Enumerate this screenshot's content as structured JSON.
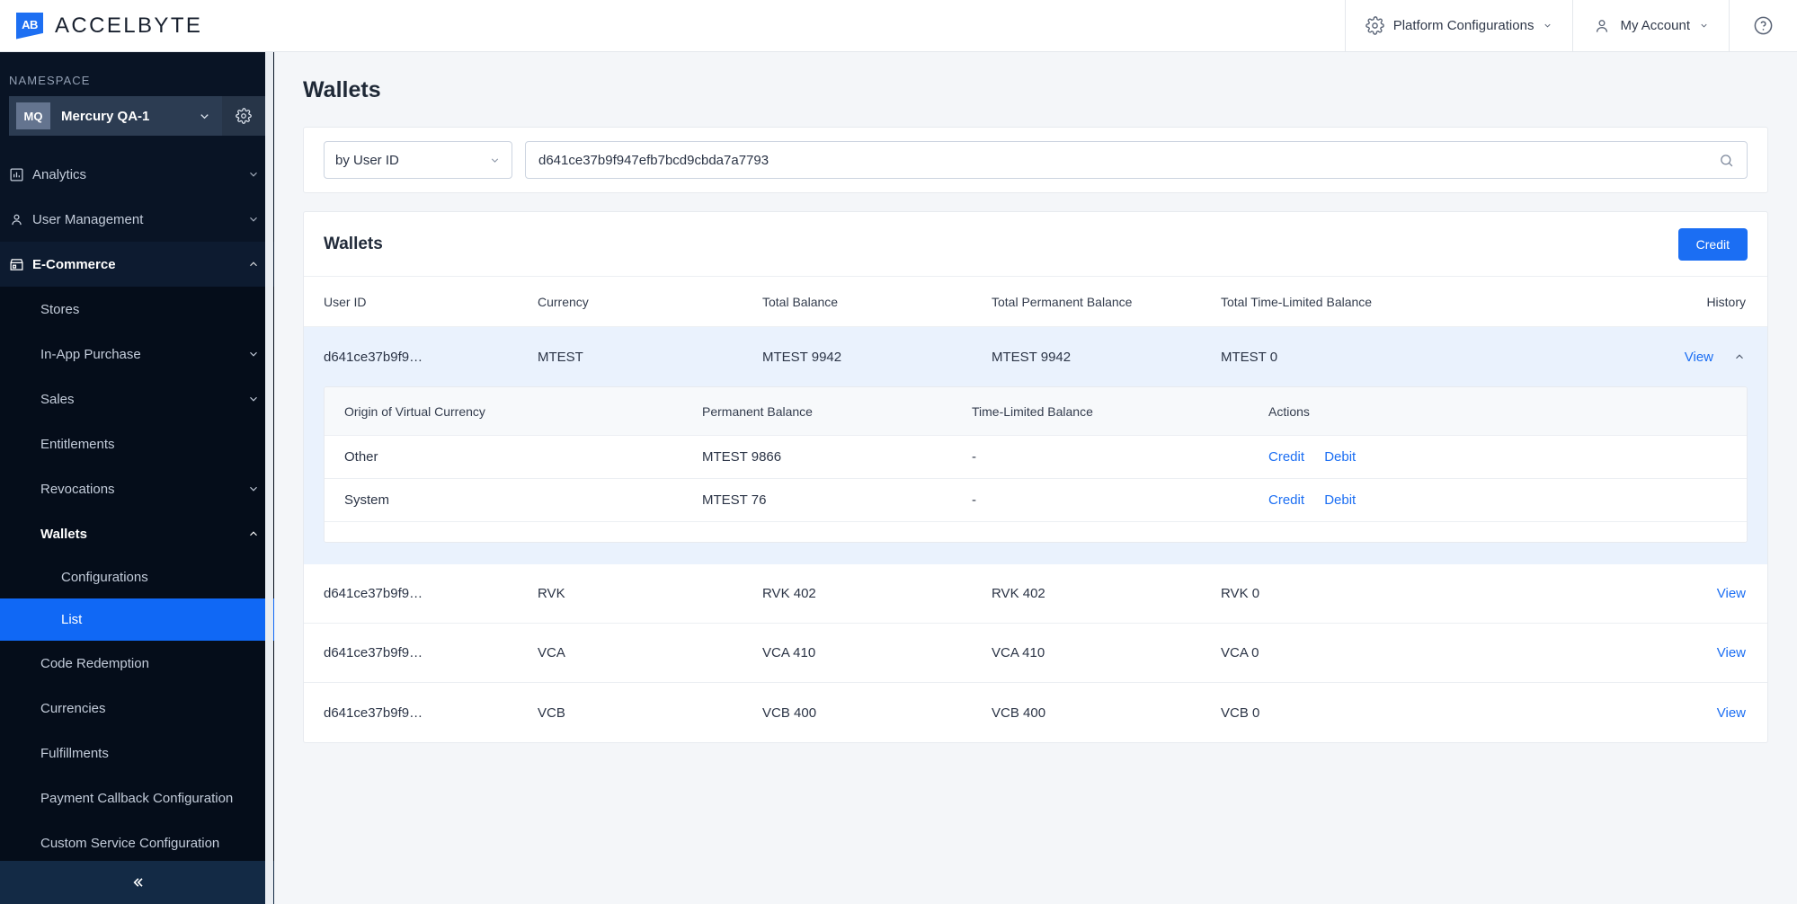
{
  "header": {
    "brand": "ACCELBYTE",
    "logo_monogram": "AB",
    "platform_configurations": "Platform Configurations",
    "my_account": "My Account",
    "gear_icon": "gear-icon",
    "user_icon": "user-icon",
    "help_icon": "help-circle-icon",
    "chevron_icon": "chevron-down-icon"
  },
  "sidebar": {
    "namespace_label": "NAMESPACE",
    "namespace_badge": "MQ",
    "namespace_name": "Mercury QA-1",
    "namespace_gear_icon": "gear-icon",
    "collapse_icon": "double-chevron-left-icon",
    "nav": [
      {
        "label": "Analytics",
        "icon": "bar-chart-icon",
        "chevron": "down"
      },
      {
        "label": "User Management",
        "icon": "user-icon",
        "chevron": "down"
      },
      {
        "label": "E-Commerce",
        "icon": "store-icon",
        "chevron": "up",
        "active": true
      }
    ],
    "ecommerce_items": [
      {
        "label": "Stores",
        "chevron": ""
      },
      {
        "label": "In-App Purchase",
        "chevron": "down"
      },
      {
        "label": "Sales",
        "chevron": "down"
      },
      {
        "label": "Entitlements",
        "chevron": ""
      },
      {
        "label": "Revocations",
        "chevron": "down"
      },
      {
        "label": "Wallets",
        "chevron": "up",
        "bold": true
      }
    ],
    "wallets_items": [
      {
        "label": "Configurations",
        "selected": false
      },
      {
        "label": "List",
        "selected": true
      }
    ],
    "ecommerce_items_after": [
      {
        "label": "Code Redemption",
        "chevron": ""
      },
      {
        "label": "Currencies",
        "chevron": ""
      },
      {
        "label": "Fulfillments",
        "chevron": ""
      },
      {
        "label": "Payment Callback Configuration",
        "chevron": ""
      },
      {
        "label": "Custom Service Configuration",
        "chevron": ""
      }
    ]
  },
  "main": {
    "page_title": "Wallets",
    "filter": {
      "select_value": "by User ID",
      "search_value": "d641ce37b9f947efb7bcd9cbda7a7793",
      "search_icon": "search-icon"
    },
    "table": {
      "title": "Wallets",
      "credit_button": "Credit",
      "columns": [
        "User ID",
        "Currency",
        "Total Balance",
        "Total Permanent Balance",
        "Total Time-Limited Balance",
        "History"
      ],
      "rows": [
        {
          "user_id": "d641ce37b9f9…",
          "currency": "MTEST",
          "total_balance": "MTEST 9942",
          "total_permanent_balance": "MTEST 9942",
          "total_time_limited_balance": "MTEST 0",
          "history": "View",
          "expanded": true,
          "chevron": "up"
        },
        {
          "user_id": "d641ce37b9f9…",
          "currency": "RVK",
          "total_balance": "RVK 402",
          "total_permanent_balance": "RVK 402",
          "total_time_limited_balance": "RVK 0",
          "history": "View",
          "expanded": false
        },
        {
          "user_id": "d641ce37b9f9…",
          "currency": "VCA",
          "total_balance": "VCA 410",
          "total_permanent_balance": "VCA 410",
          "total_time_limited_balance": "VCA 0",
          "history": "View",
          "expanded": false
        },
        {
          "user_id": "d641ce37b9f9…",
          "currency": "VCB",
          "total_balance": "VCB 400",
          "total_permanent_balance": "VCB 400",
          "total_time_limited_balance": "VCB 0",
          "history": "View",
          "expanded": false
        }
      ],
      "sub_table": {
        "columns": [
          "Origin of Virtual Currency",
          "Permanent Balance",
          "Time-Limited Balance",
          "Actions"
        ],
        "rows": [
          {
            "origin": "Other",
            "permanent_balance": "MTEST 9866",
            "time_limited_balance": "-",
            "action_credit": "Credit",
            "action_debit": "Debit"
          },
          {
            "origin": "System",
            "permanent_balance": "MTEST 76",
            "time_limited_balance": "-",
            "action_credit": "Credit",
            "action_debit": "Debit"
          }
        ]
      }
    }
  },
  "colors": {
    "accent_blue": "#1b6ef3",
    "selected_blue": "#1068f5",
    "sidebar_dark": "#091425",
    "expanded_row": "#eaf2fd"
  }
}
